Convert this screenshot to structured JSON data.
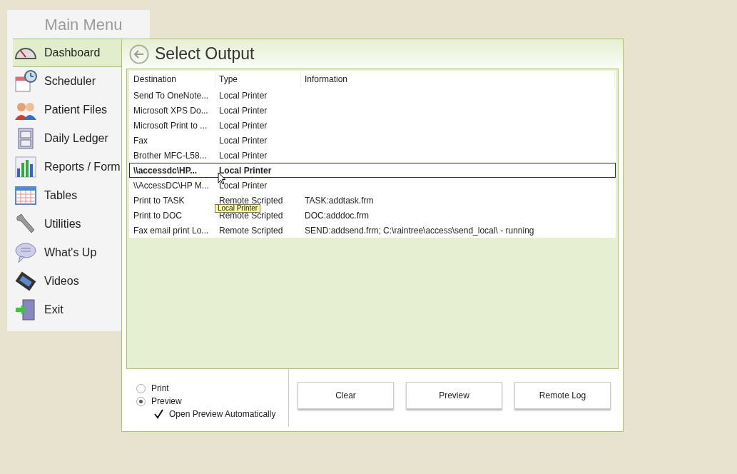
{
  "main_menu": {
    "title": "Main Menu",
    "items": [
      {
        "label": "Dashboard",
        "kind": "gauge",
        "selected": true
      },
      {
        "label": "Scheduler",
        "kind": "calendar-clock",
        "selected": false
      },
      {
        "label": "Patient Files",
        "kind": "people",
        "selected": false
      },
      {
        "label": "Daily Ledger",
        "kind": "cabinet",
        "selected": false
      },
      {
        "label": "Reports / Form",
        "kind": "chart",
        "selected": false
      },
      {
        "label": "Tables",
        "kind": "grid",
        "selected": false
      },
      {
        "label": "Utilities",
        "kind": "wrench",
        "selected": false
      },
      {
        "label": "What's Up",
        "kind": "bubble",
        "selected": false
      },
      {
        "label": "Videos",
        "kind": "film",
        "selected": false
      },
      {
        "label": "Exit",
        "kind": "door",
        "selected": false
      }
    ]
  },
  "dialog": {
    "title": "Select Output",
    "table": {
      "columns": [
        "Destination",
        "Type",
        "Information"
      ],
      "rows": [
        {
          "cells": [
            "Send To OneNote...",
            "Local Printer",
            ""
          ],
          "selected": false
        },
        {
          "cells": [
            "Microsoft XPS Do...",
            "Local Printer",
            ""
          ],
          "selected": false
        },
        {
          "cells": [
            "Microsoft Print to ...",
            "Local Printer",
            ""
          ],
          "selected": false
        },
        {
          "cells": [
            "Fax",
            "Local Printer",
            ""
          ],
          "selected": false
        },
        {
          "cells": [
            "Brother MFC-L58...",
            "Local Printer",
            ""
          ],
          "selected": false
        },
        {
          "cells": [
            "\\\\accessdc\\HP...",
            "Local Printer",
            ""
          ],
          "selected": true
        },
        {
          "cells": [
            "\\\\AccessDC\\HP M...",
            "Local Printer",
            ""
          ],
          "selected": false
        },
        {
          "cells": [
            "Print to TASK",
            "Remote Scripted",
            "TASK:addtask.frm"
          ],
          "selected": false
        },
        {
          "cells": [
            "Print to DOC",
            "Remote Scripted",
            "DOC:adddoc.frm"
          ],
          "selected": false
        },
        {
          "cells": [
            "Fax email print Lo...",
            "Remote Scripted",
            "SEND:addsend.frm; C:\\raintree\\access\\send_local\\ - running"
          ],
          "selected": false
        }
      ]
    },
    "tooltip": "Local Printer",
    "output_options": [
      {
        "label": "Print",
        "selected": false
      },
      {
        "label": "Preview",
        "selected": true
      }
    ],
    "auto_preview": {
      "label": "Open Preview Automatically",
      "checked": true
    },
    "buttons": [
      "Clear",
      "Preview",
      "Remote Log"
    ]
  }
}
